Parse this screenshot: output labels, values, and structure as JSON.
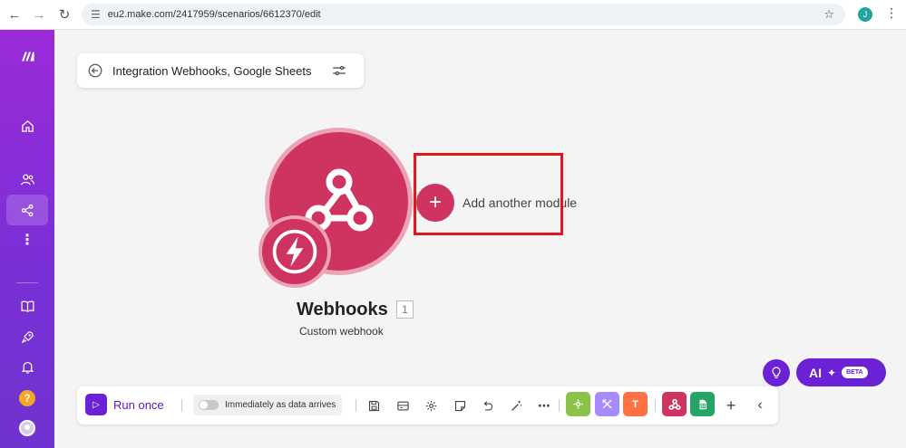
{
  "browser": {
    "url": "eu2.make.com/2417959/scenarios/6612370/edit",
    "profile_initial": "J"
  },
  "sidebar": {
    "items": [
      {
        "icon": "make-logo-icon"
      },
      {
        "icon": "home-icon"
      },
      {
        "icon": "team-icon"
      },
      {
        "icon": "scenarios-icon",
        "active": true
      },
      {
        "icon": "more-icon"
      },
      {
        "icon": "docs-icon"
      },
      {
        "icon": "launch-icon"
      },
      {
        "icon": "bell-icon"
      },
      {
        "icon": "help-icon",
        "label": "?"
      },
      {
        "icon": "user-avatar"
      }
    ]
  },
  "scenario": {
    "name": "Integration Webhooks, Google Sheets"
  },
  "module": {
    "title": "Webhooks",
    "count": "1",
    "subtitle": "Custom webhook",
    "color": "#cf3460"
  },
  "add_module": {
    "symbol": "+",
    "label": "Add another module"
  },
  "toolbar": {
    "run_label": "Run once",
    "schedule_label": "Immediately as data arrives",
    "tiles": [
      {
        "name": "tools-tile",
        "color": "#8bc34a"
      },
      {
        "name": "flow-control-tile",
        "color": "#a78bfa"
      },
      {
        "name": "text-parser-tile",
        "color": "#ff7043",
        "label": "T"
      },
      {
        "name": "webhooks-tile",
        "color": "#cf3460"
      },
      {
        "name": "google-sheets-tile",
        "color": "#23a566"
      }
    ]
  },
  "ai": {
    "label": "AI",
    "badge": "BETA"
  }
}
